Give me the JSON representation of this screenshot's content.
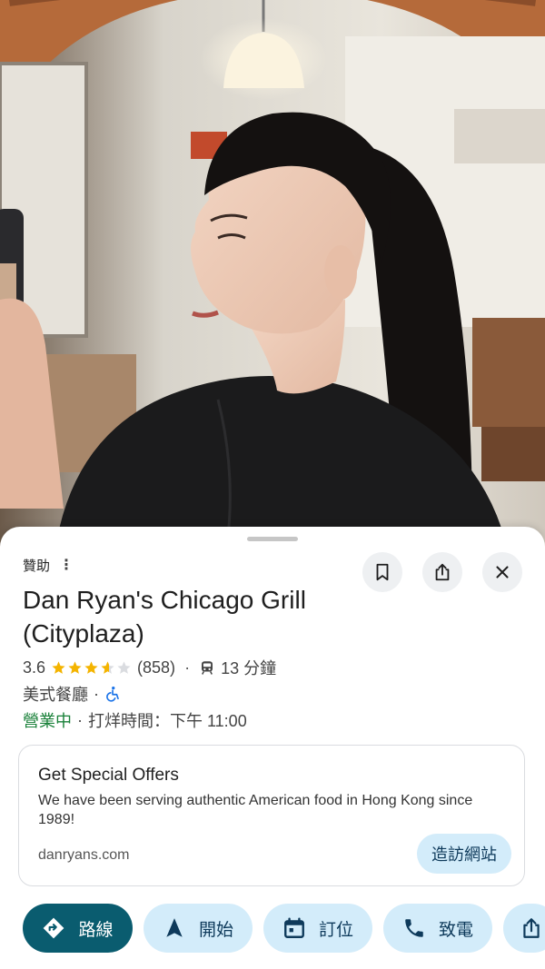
{
  "place": {
    "sponsored_label": "贊助",
    "name": "Dan Ryan's Chicago Grill (Cityplaza)",
    "rating": "3.6",
    "rating_value": 3.6,
    "review_count": "(858)",
    "transit_time": "13 分鐘",
    "category": "美式餐廳",
    "open_status": "營業中",
    "closing_text": "打烊時間：下午 11:00"
  },
  "promo": {
    "title": "Get Special Offers",
    "body": "We have been serving authentic American food in Hong Kong since 1989!",
    "url": "danryans.com",
    "cta": "造訪網站"
  },
  "actions": [
    {
      "label": "路線",
      "icon": "directions-icon"
    },
    {
      "label": "開始",
      "icon": "navigation-arrow-icon"
    },
    {
      "label": "訂位",
      "icon": "calendar-icon"
    },
    {
      "label": "致電",
      "icon": "phone-icon"
    },
    {
      "label": "",
      "icon": "share-icon"
    }
  ],
  "colors": {
    "accent_dark": "#0a5c6f",
    "chip_bg": "#d3ecfa",
    "open_green": "#188038",
    "star": "#f4b400"
  }
}
